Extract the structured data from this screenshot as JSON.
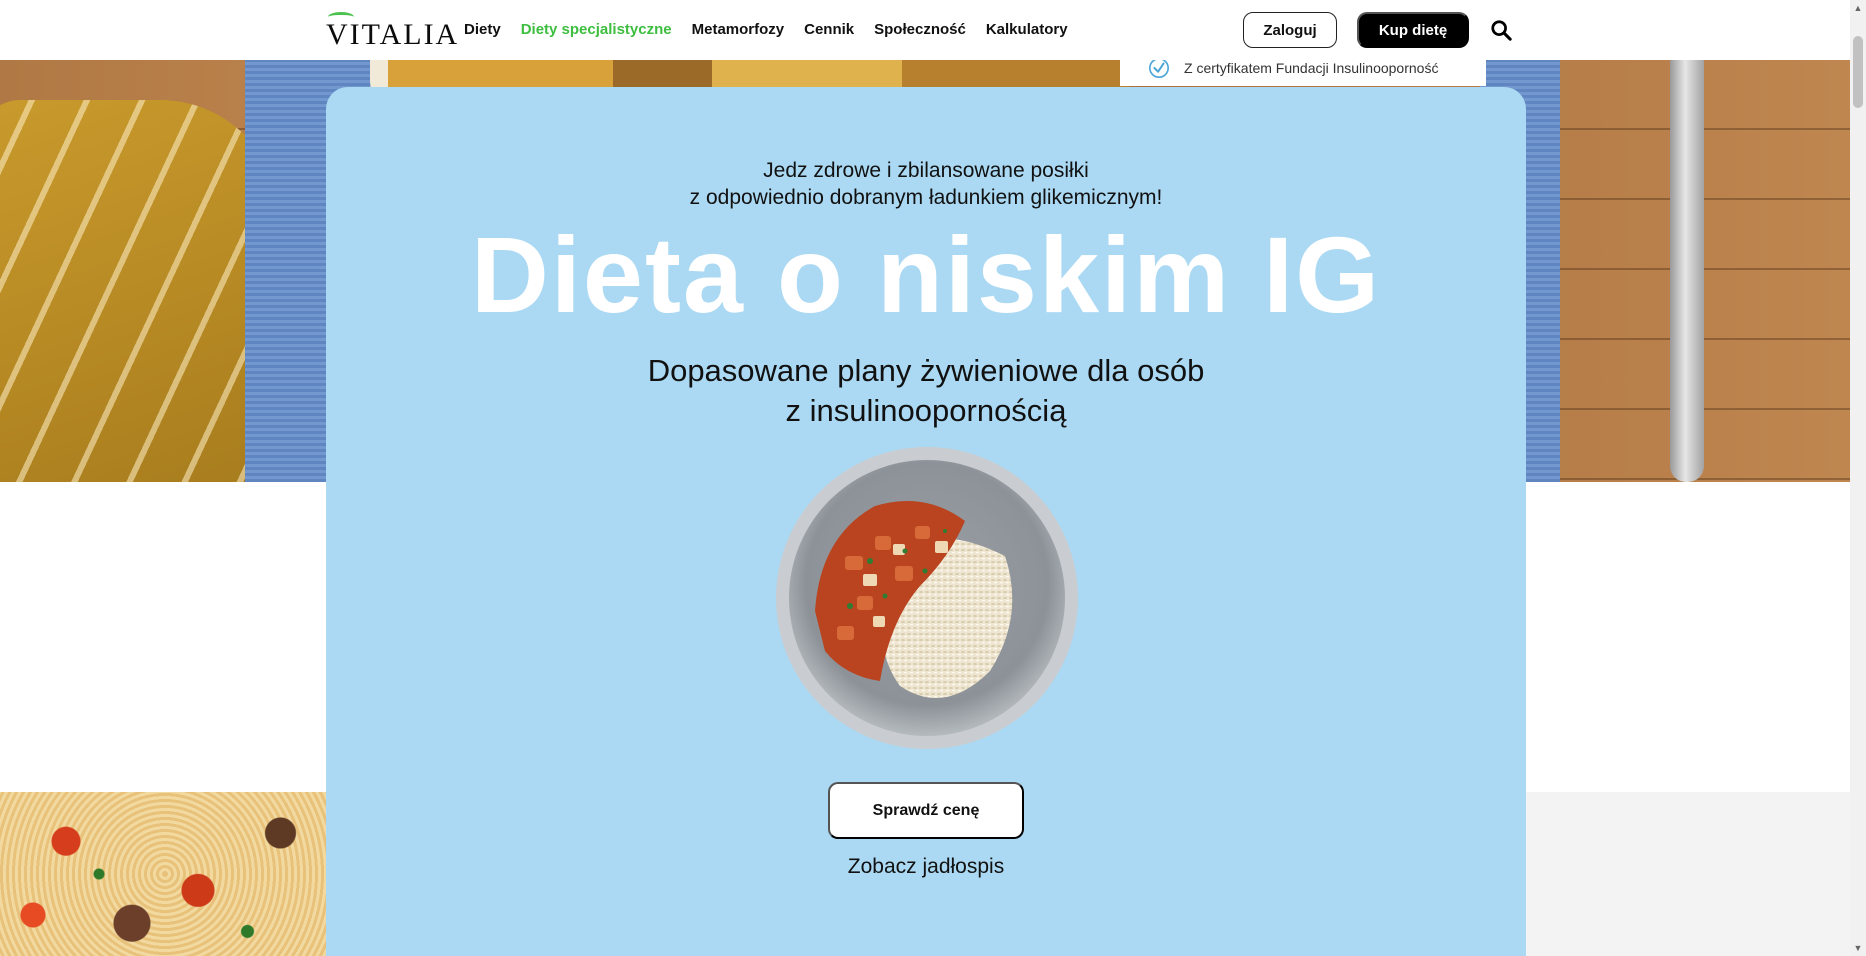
{
  "header": {
    "logo_text": "VITALIA",
    "nav": [
      {
        "label": "Diety",
        "active": false
      },
      {
        "label": "Diety specjalistyczne",
        "active": true
      },
      {
        "label": "Metamorfozy",
        "active": false
      },
      {
        "label": "Cennik",
        "active": false
      },
      {
        "label": "Społeczność",
        "active": false
      },
      {
        "label": "Kalkulatory",
        "active": false
      }
    ],
    "login_label": "Zaloguj",
    "buy_label": "Kup dietę",
    "search_icon": "search-icon"
  },
  "certificate": {
    "text": "Z certyfikatem Fundacji Insulinooporność",
    "icon": "check-circle-icon"
  },
  "hero": {
    "lead_line1": "Jedz zdrowe i zbilansowane posiłki",
    "lead_line2": "z odpowiednio dobranym ładunkiem glikemicznym!",
    "title": "Dieta o niskim IG",
    "subtitle_line1": "Dopasowane plany żywieniowe dla osób",
    "subtitle_line2": "z insulinoopornością",
    "cta_label": "Sprawdź cenę",
    "menu_link": "Zobacz jadłospis"
  },
  "colors": {
    "accent_green": "#3dbe3f",
    "card_blue": "#abd9f3",
    "button_black": "#000000"
  }
}
